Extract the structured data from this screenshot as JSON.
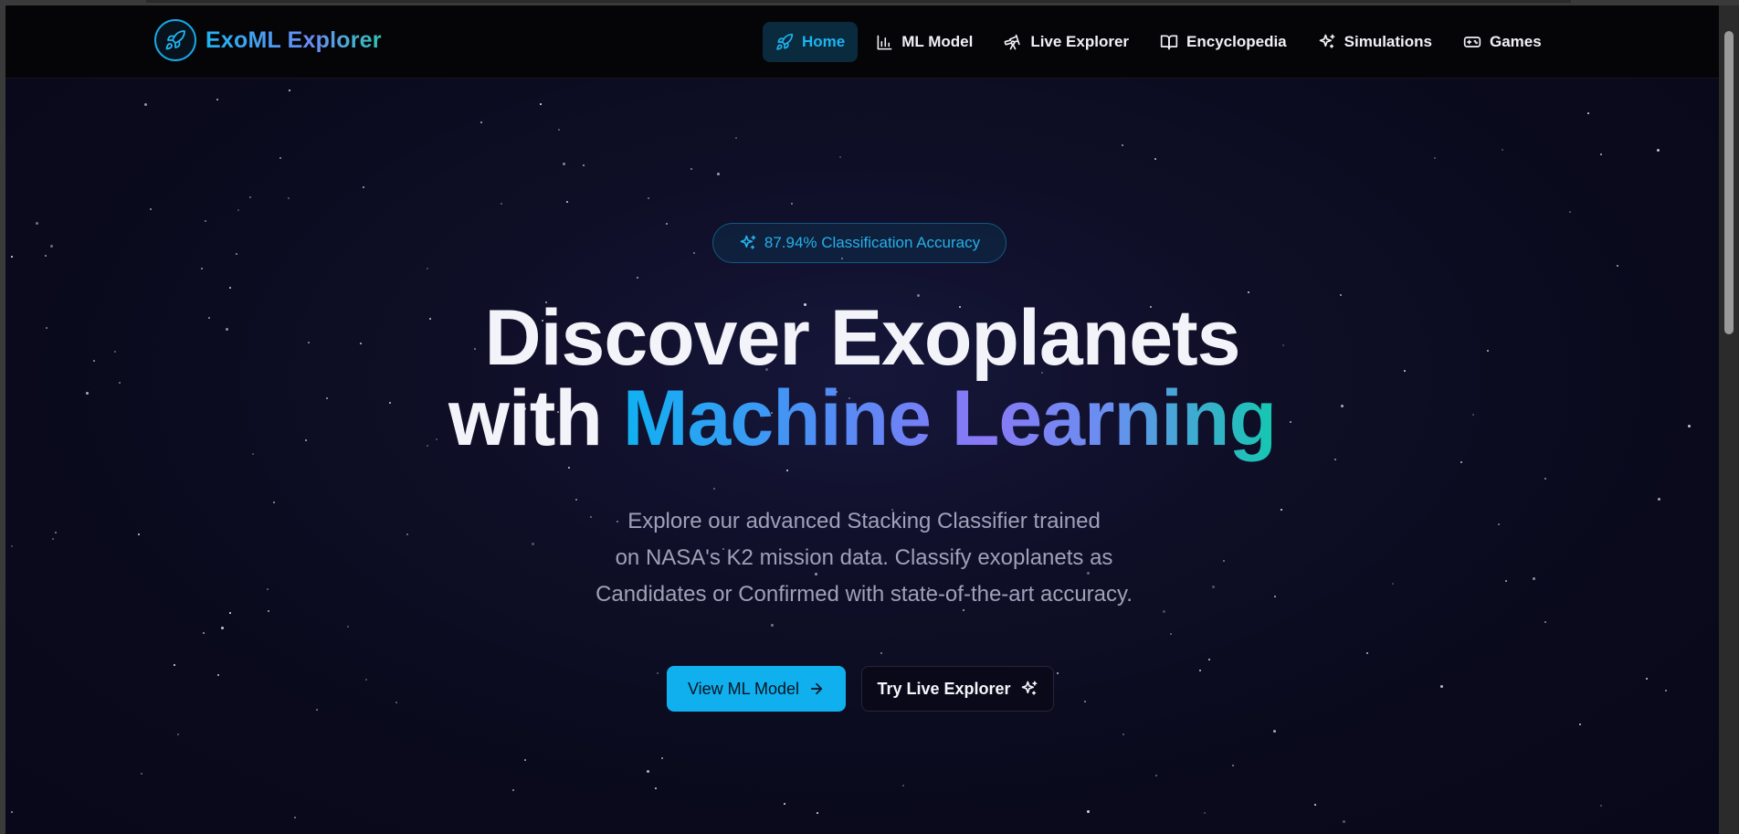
{
  "brand": {
    "name": "ExoML Explorer"
  },
  "nav": {
    "items": [
      {
        "label": "Home",
        "icon": "rocket-icon",
        "active": true
      },
      {
        "label": "ML Model",
        "icon": "bar-chart-icon",
        "active": false
      },
      {
        "label": "Live Explorer",
        "icon": "telescope-icon",
        "active": false
      },
      {
        "label": "Encyclopedia",
        "icon": "book-icon",
        "active": false
      },
      {
        "label": "Simulations",
        "icon": "sparkles-icon",
        "active": false
      },
      {
        "label": "Games",
        "icon": "gamepad-icon",
        "active": false
      }
    ]
  },
  "hero": {
    "badge": "87.94% Classification Accuracy",
    "headline_line1": "Discover Exoplanets",
    "headline_line2_plain": "with",
    "headline_line2_gradient": "Machine Learning",
    "subtext_lines": [
      "Explore our advanced Stacking Classifier trained",
      "on NASA's K2 mission data. Classify exoplanets as",
      "Candidates or Confirmed with state-of-the-art accuracy."
    ],
    "primary_button": "View ML Model",
    "secondary_button": "Try Live Explorer"
  },
  "colors": {
    "accent": "#10b0ee",
    "background": "#0a0a1c",
    "teal": "#14c8b0",
    "violet": "#8a78f5"
  }
}
